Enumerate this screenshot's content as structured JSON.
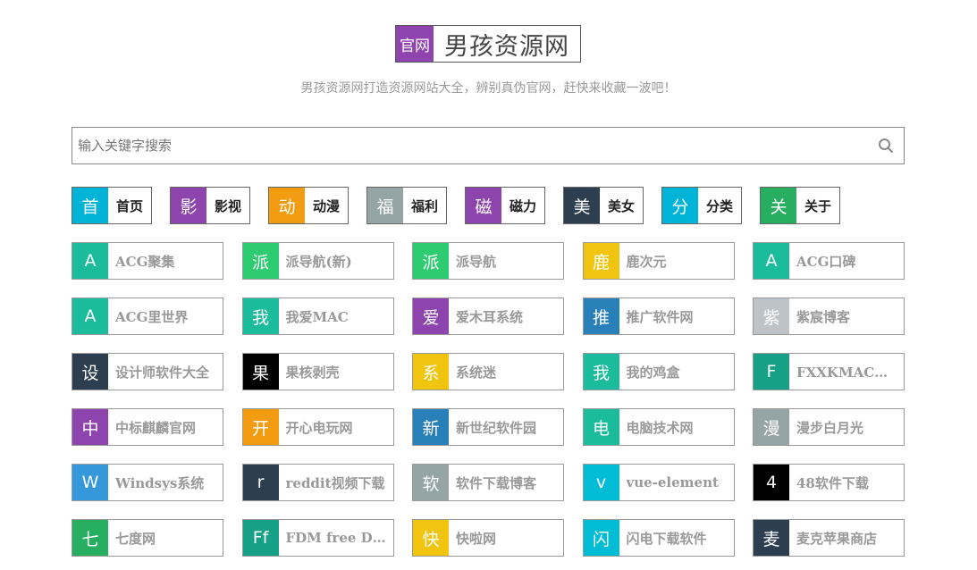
{
  "header": {
    "badge": "官网",
    "title": "男孩资源网",
    "subtitle": "男孩资源网打造资源网站大全，辨别真伪官网，赶快来收藏一波吧！"
  },
  "search": {
    "placeholder": "输入关键字搜索",
    "value": ""
  },
  "categories": [
    {
      "icon": "首",
      "label": "首页",
      "color": "#00b4d8"
    },
    {
      "icon": "影",
      "label": "影视",
      "color": "#8e44ad"
    },
    {
      "icon": "动",
      "label": "动漫",
      "color": "#f39c12"
    },
    {
      "icon": "福",
      "label": "福利",
      "color": "#95a5a6"
    },
    {
      "icon": "磁",
      "label": "磁力",
      "color": "#8e44ad"
    },
    {
      "icon": "美",
      "label": "美女",
      "color": "#2c3e50"
    },
    {
      "icon": "分",
      "label": "分类",
      "color": "#00b4d8"
    },
    {
      "icon": "关",
      "label": "关于",
      "color": "#27ae60"
    }
  ],
  "sites": [
    {
      "icon": "A",
      "label": "ACG聚集",
      "color": "#1abc9c"
    },
    {
      "icon": "派",
      "label": "派导航(新)",
      "color": "#2ecc71"
    },
    {
      "icon": "派",
      "label": "派导航",
      "color": "#2ecc71"
    },
    {
      "icon": "鹿",
      "label": "鹿次元",
      "color": "#f1c40f"
    },
    {
      "icon": "A",
      "label": "ACG口碑",
      "color": "#1abc9c"
    },
    {
      "icon": "A",
      "label": "ACG里世界",
      "color": "#1abc9c"
    },
    {
      "icon": "我",
      "label": "我爱MAC",
      "color": "#1abc9c"
    },
    {
      "icon": "爱",
      "label": "爱木耳系统",
      "color": "#8e44ad"
    },
    {
      "icon": "推",
      "label": "推广软件网",
      "color": "#2980b9"
    },
    {
      "icon": "紫",
      "label": "紫宸博客",
      "color": "#bdc3c7"
    },
    {
      "icon": "设",
      "label": "设计师软件大全",
      "color": "#2c3e50"
    },
    {
      "icon": "果",
      "label": "果核剥壳",
      "color": "#000000"
    },
    {
      "icon": "系",
      "label": "系统迷",
      "color": "#f1c40f"
    },
    {
      "icon": "我",
      "label": "我的鸡盒",
      "color": "#1abc9c"
    },
    {
      "icon": "F",
      "label": "FXXKMAC软件",
      "color": "#16a085"
    },
    {
      "icon": "中",
      "label": "中标麒麟官网",
      "color": "#8e44ad"
    },
    {
      "icon": "开",
      "label": "开心电玩网",
      "color": "#f39c12"
    },
    {
      "icon": "新",
      "label": "新世纪软件园",
      "color": "#2980b9"
    },
    {
      "icon": "电",
      "label": "电脑技术网",
      "color": "#1abc9c"
    },
    {
      "icon": "漫",
      "label": "漫步白月光",
      "color": "#95a5a6"
    },
    {
      "icon": "W",
      "label": "Windsys系统",
      "color": "#3498db"
    },
    {
      "icon": "r",
      "label": "reddit视频下载",
      "color": "#2c3e50"
    },
    {
      "icon": "软",
      "label": "软件下载博客",
      "color": "#95a5a6"
    },
    {
      "icon": "v",
      "label": "vue-element",
      "color": "#00bcd4"
    },
    {
      "icon": "4",
      "label": "48软件下载",
      "color": "#000000"
    },
    {
      "icon": "七",
      "label": "七度网",
      "color": "#27ae60"
    },
    {
      "icon": "Ff",
      "label": "FDM free Download",
      "color": "#16a085"
    },
    {
      "icon": "快",
      "label": "快啦网",
      "color": "#f1c40f"
    },
    {
      "icon": "闪",
      "label": "闪电下载软件",
      "color": "#00bcd4"
    },
    {
      "icon": "麦",
      "label": "麦克苹果商店",
      "color": "#2c3e50"
    }
  ]
}
